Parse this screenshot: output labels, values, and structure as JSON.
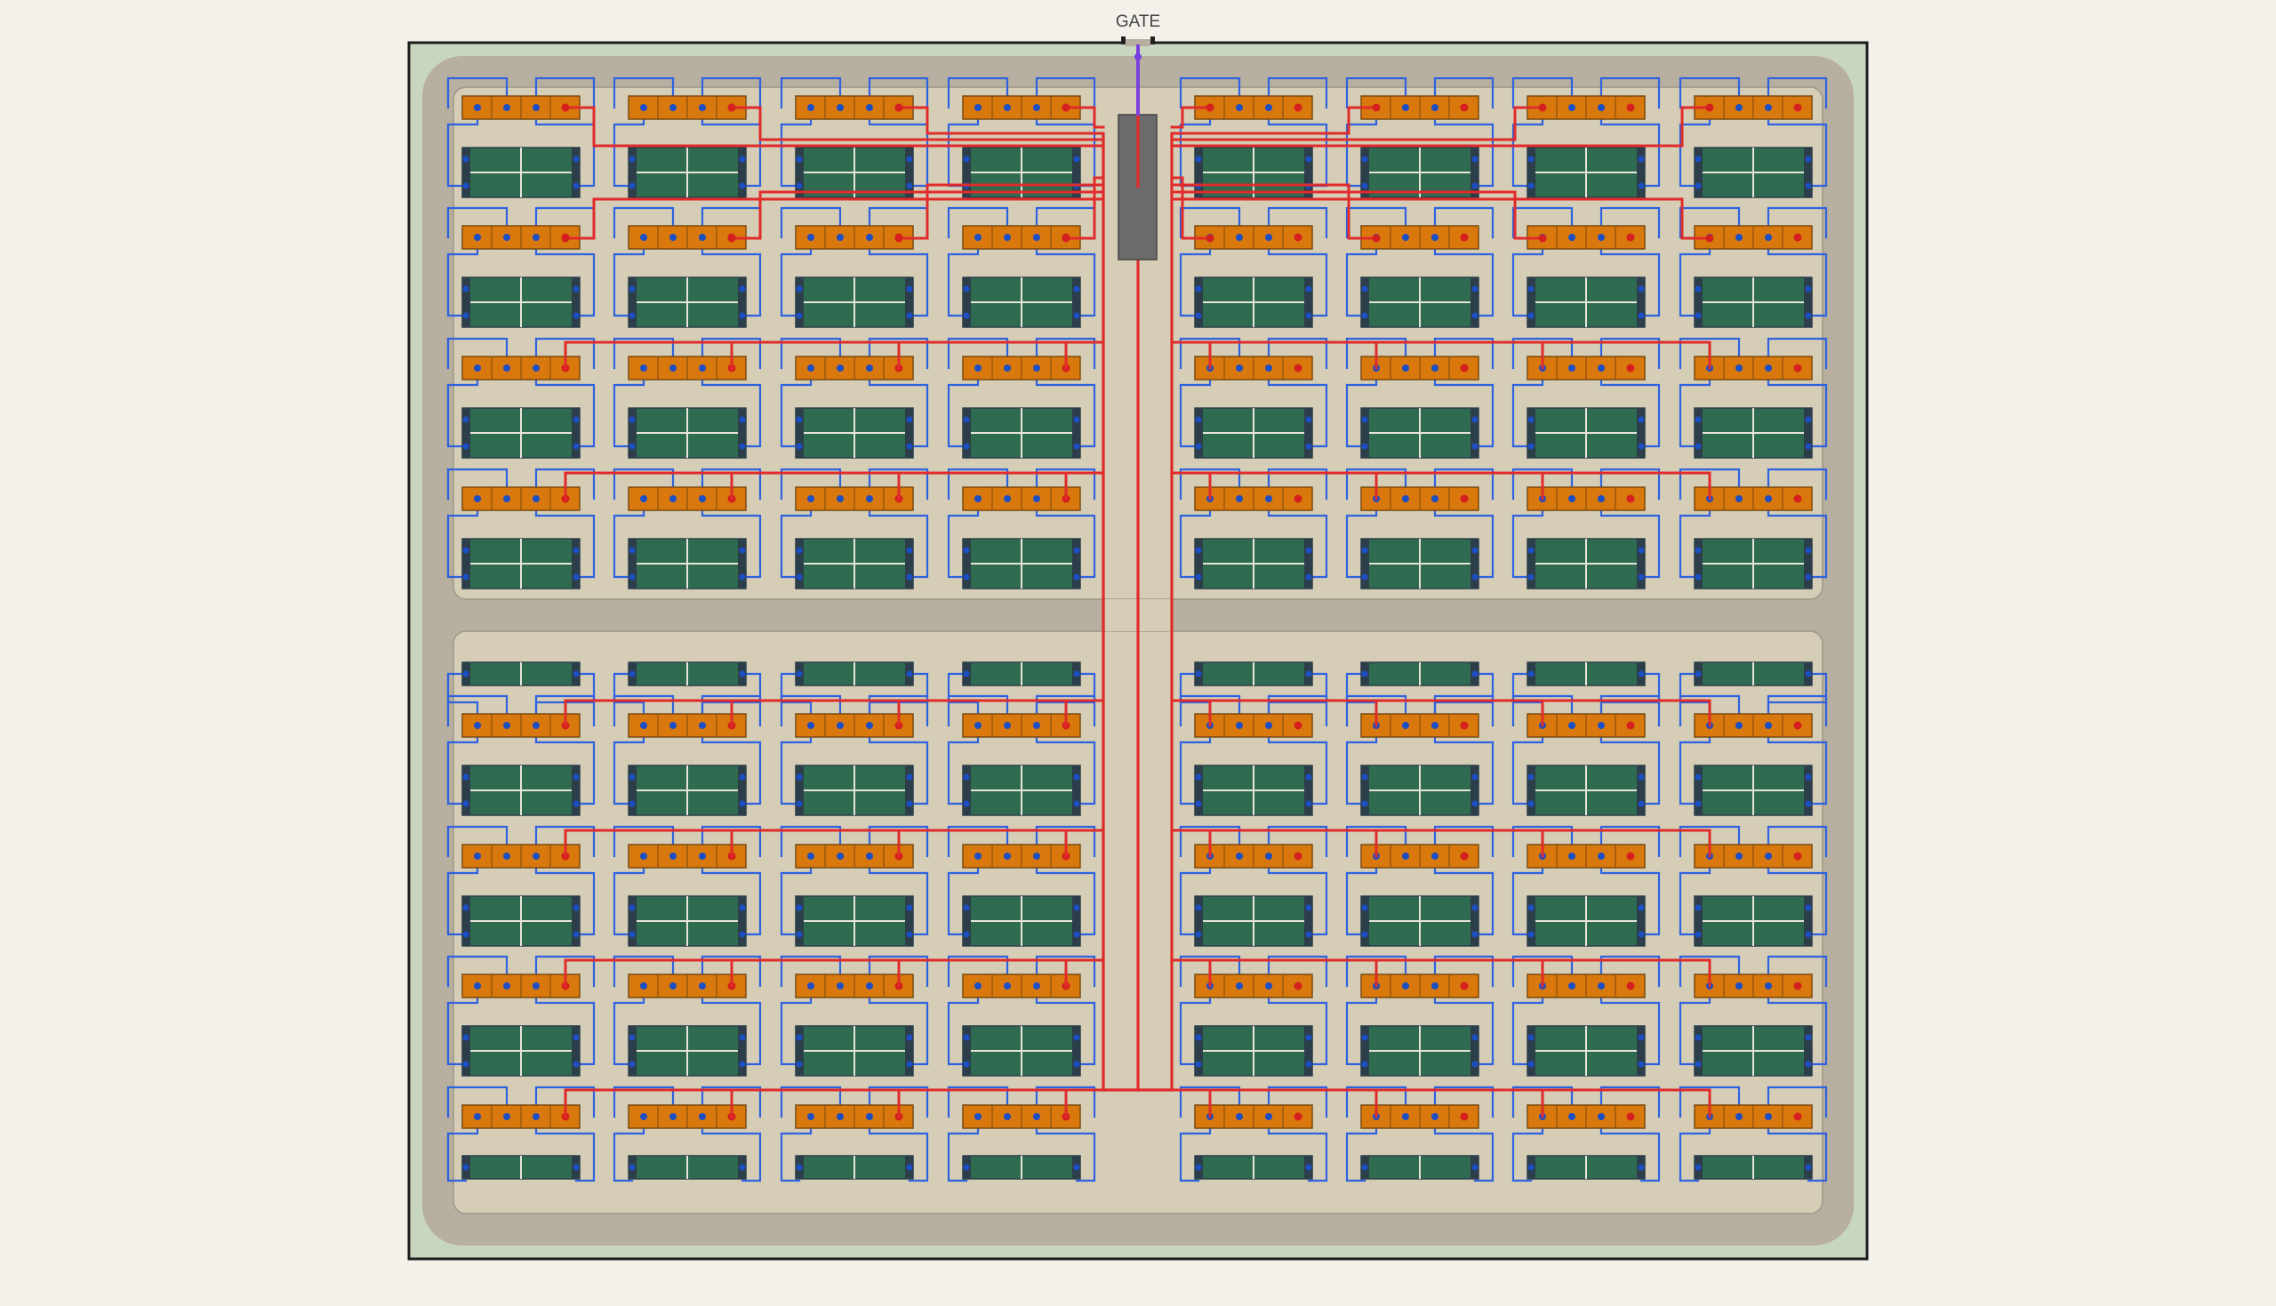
{
  "gate": {
    "label": "GATE"
  },
  "colors": {
    "page_background": "#f3f1ea",
    "site_grass": "#c8d6bf",
    "border": "#1c1c1c",
    "path_stone": "#b7afa0",
    "floor_sand": "#d6cdb6",
    "grave_plot": "#2e6b50",
    "grave_edge": "#2c3e4a",
    "tree_row": "#d9780c",
    "tree_row_edge": "#7a4a10",
    "main_path": "#e02b2b",
    "side_path": "#2e62e0",
    "node": "#1d4fc4",
    "main_node": "#d61f1f",
    "entrance_path": "#7b3fe0",
    "central_structure": "#6b6b6b"
  },
  "legend": {
    "grave_plot": "grave-plot",
    "tree_row": "tree-row",
    "main_path": "main-path",
    "side_path": "side-path",
    "central_structure": "central-structure"
  }
}
